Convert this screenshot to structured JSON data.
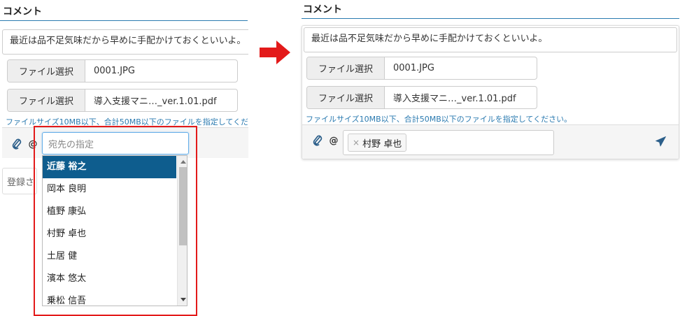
{
  "comment": {
    "title": "コメント",
    "text": "最近は品不足気味だから早めに手配かけておくといいよ。",
    "file_button_label": "ファイル選択",
    "files": [
      "0001.JPG",
      "導入支援マニ…_ver.1.01.pdf"
    ],
    "size_hint": "ファイルサイズ10MB以下、合計50MB以下のファイルを指定してください。",
    "mention_symbol": "@",
    "destination_placeholder": "宛先の指定",
    "register_label": "登録さ"
  },
  "dropdown": {
    "options": [
      "近藤 裕之",
      "岡本 良明",
      "植野 康弘",
      "村野 卓也",
      "土居 健",
      "濱本 悠太",
      "乗松 信吾"
    ],
    "selected_index": 0
  },
  "result": {
    "selected_tag": "村野 卓也",
    "tag_remove": "×"
  },
  "colors": {
    "accent": "#2a7ab0",
    "selection": "#0e5d8e",
    "highlight_frame": "#e31a1a",
    "arrow": "#e31a1a"
  },
  "icons": [
    "paperclip-icon",
    "at-icon",
    "send-icon",
    "right-arrow-icon",
    "scroll-up-icon",
    "scroll-down-icon"
  ]
}
